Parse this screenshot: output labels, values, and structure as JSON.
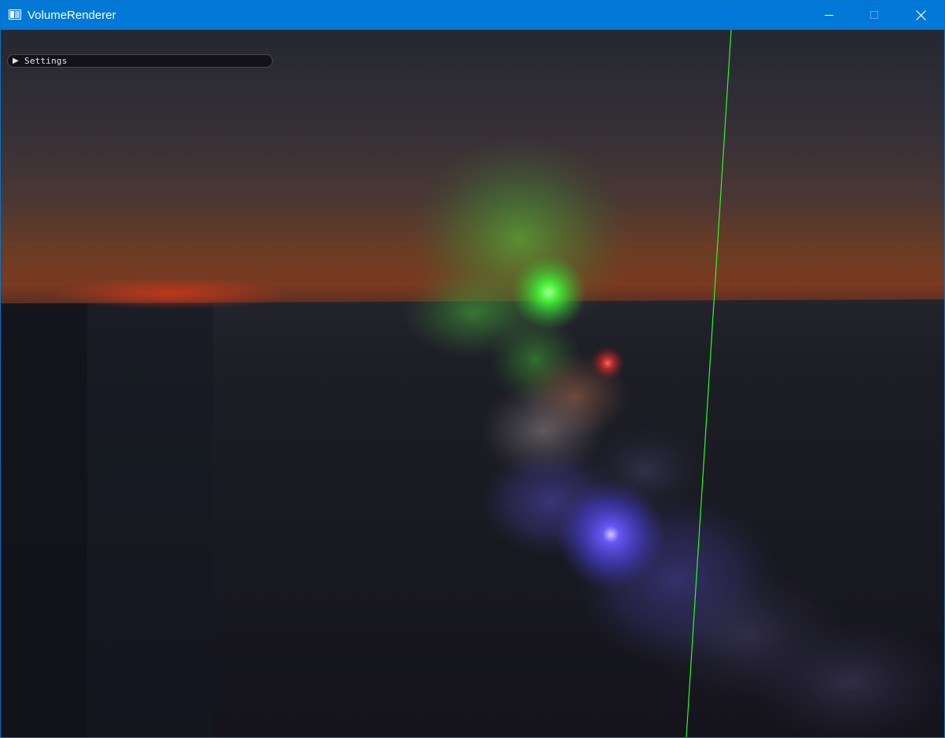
{
  "window": {
    "title": "VolumeRenderer",
    "icon": "app-window-icon",
    "controls": {
      "minimize": "minimize-icon",
      "maximize": "maximize-icon",
      "close": "close-icon"
    }
  },
  "settings_panel": {
    "label": "Settings",
    "collapsed": true,
    "toggle_icon": "triangle-right-icon"
  },
  "scene": {
    "lights": [
      {
        "name": "green-light",
        "color": "#43ff3a"
      },
      {
        "name": "red-light",
        "color": "#ff3030"
      },
      {
        "name": "blue-light",
        "color": "#5050ff"
      }
    ],
    "axis_line_color": "#22ff22",
    "horizon_glow_color": "#ff3a18"
  }
}
